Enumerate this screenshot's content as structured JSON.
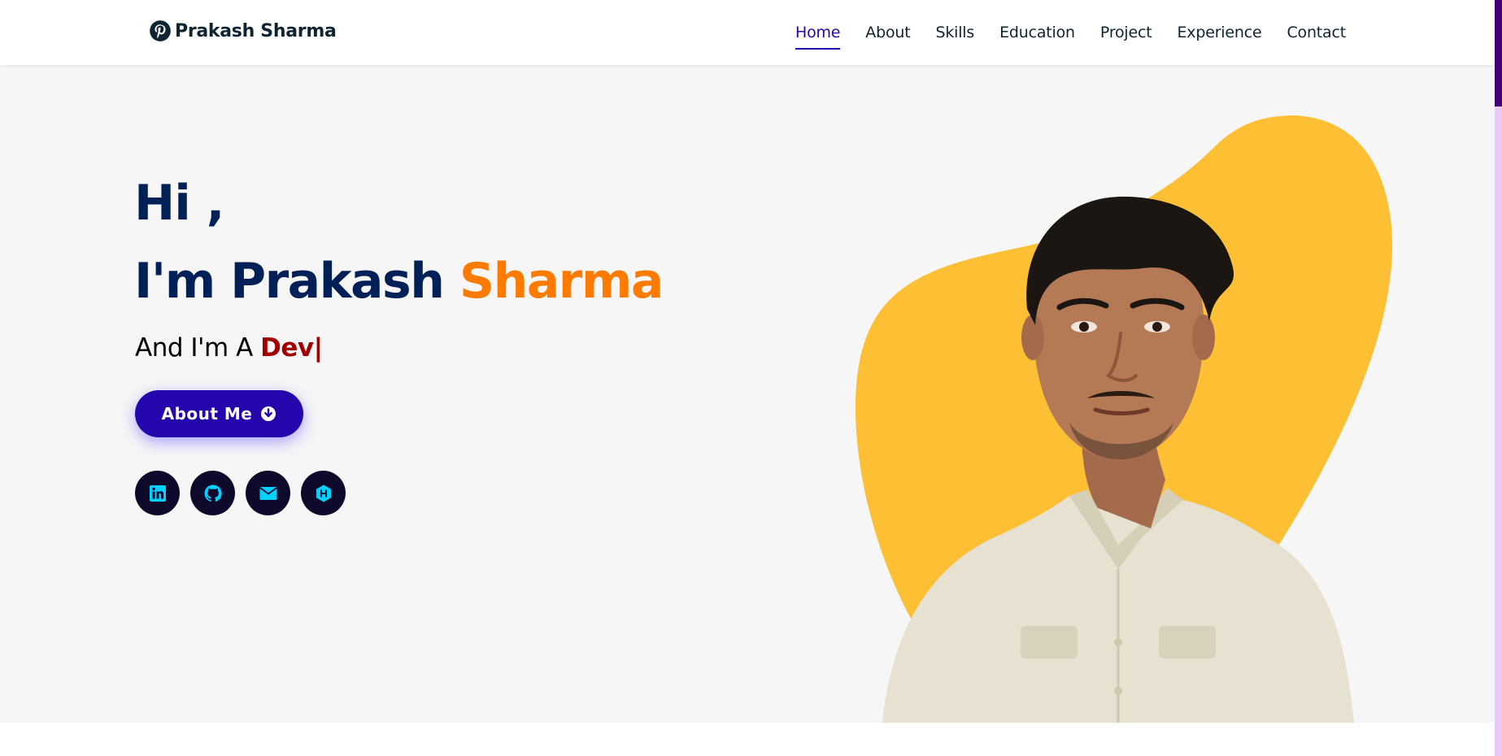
{
  "header": {
    "logo_text": "Prakash Sharma",
    "logo_icon": "pinterest-icon",
    "nav": [
      {
        "label": "Home",
        "active": true
      },
      {
        "label": "About",
        "active": false
      },
      {
        "label": "Skills",
        "active": false
      },
      {
        "label": "Education",
        "active": false
      },
      {
        "label": "Project",
        "active": false
      },
      {
        "label": "Experience",
        "active": false
      },
      {
        "label": "Contact",
        "active": false
      }
    ]
  },
  "hero": {
    "greeting": "Hi ,",
    "intro_prefix": "I'm Prakash ",
    "intro_accent": "Sharma",
    "tagline_prefix": "And I'm A ",
    "tagline_typed": "Dev|",
    "about_button_label": "About Me",
    "about_button_icon": "arrow-circle-down-icon",
    "socials": [
      {
        "icon": "linkedin-icon"
      },
      {
        "icon": "github-icon"
      },
      {
        "icon": "envelope-icon"
      },
      {
        "icon": "hashnode-icon"
      }
    ]
  },
  "colors": {
    "accent": "#2506ad",
    "name_primary": "#002057",
    "name_accent": "#ff7b00",
    "typed_text": "#a10000",
    "blob": "#fdc034",
    "social_bg": "#0e0a2b",
    "social_icon": "#00d2ff",
    "hero_bg": "#f6f6f6"
  }
}
